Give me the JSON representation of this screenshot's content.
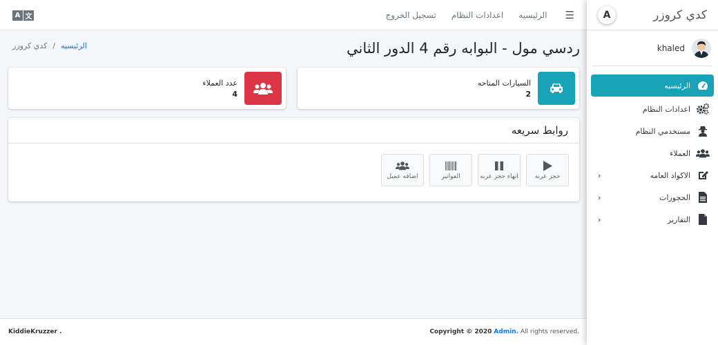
{
  "navbar": {
    "lang_icon": "translate-icon",
    "links": [
      {
        "label": "الرئيسيه"
      },
      {
        "label": "اعدادات النظام"
      },
      {
        "label": "تسجيل الخروج"
      }
    ],
    "menu_icon": "hamburger-icon"
  },
  "sidebar": {
    "brand": "كدي كروزر",
    "logo_letter": "A",
    "user_name": "khaled",
    "items": [
      {
        "label": "الرئيسيه",
        "icon": "tachometer-icon",
        "active": true
      },
      {
        "label": "اعدادات النظام",
        "icon": "gears-icon"
      },
      {
        "label": "مستخدمي النظام",
        "icon": "user-secret-icon"
      },
      {
        "label": "العملاء",
        "icon": "users-icon"
      },
      {
        "label": "الاكواد العامه",
        "icon": "edit-icon",
        "has_children": true
      },
      {
        "label": "الحجوزات",
        "icon": "file-list-icon",
        "has_children": true
      },
      {
        "label": "التقارير",
        "icon": "file-icon",
        "has_children": true
      }
    ]
  },
  "page": {
    "title": "ردسي مول - البوابه رقم 4 الدور الثاني",
    "breadcrumb": {
      "home": "الرئيسيه",
      "separator": "/",
      "current": "كدي كروزر"
    }
  },
  "info_boxes": [
    {
      "label": "السيارات المتاحه",
      "value": "2",
      "icon": "car-icon",
      "color": "#17a2b8"
    },
    {
      "label": "عدد العملاء",
      "value": "4",
      "icon": "users-icon",
      "color": "#dc3545"
    }
  ],
  "quick_links": {
    "title": "روابط سريعه",
    "buttons": [
      {
        "label": "حجز عربه",
        "icon": "play-icon"
      },
      {
        "label": "انهاء حجز عربه",
        "icon": "pause-icon"
      },
      {
        "label": "الفواتير",
        "icon": "barcode-icon"
      },
      {
        "label": "اضافه عميل",
        "icon": "users-icon"
      }
    ]
  },
  "footer": {
    "left": "KiddieKruzzer .",
    "copyright": "Copyright © 2020",
    "admin": "Admin.",
    "rights": "All rights reserved."
  },
  "colors": {
    "primary": "#17a2b8",
    "danger": "#dc3545",
    "link": "#007bff"
  }
}
